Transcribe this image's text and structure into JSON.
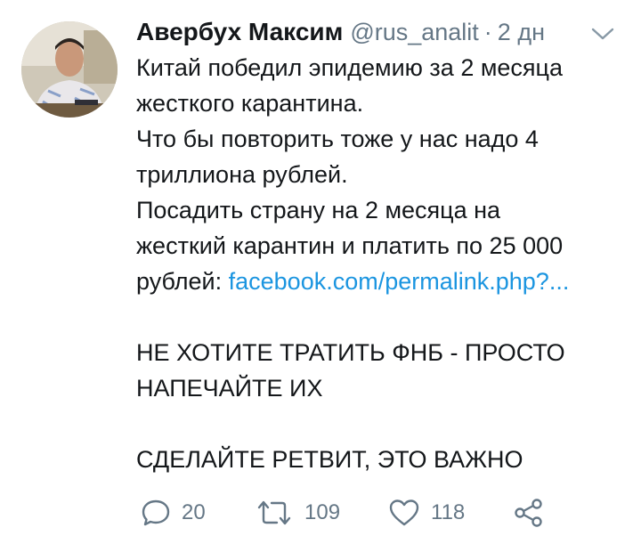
{
  "author": {
    "name": "Авербух Максим",
    "handle": "@rus_analit",
    "separator": "·",
    "time": "2 дн"
  },
  "tweet": {
    "lines": [
      "Китай победил эпидемию за 2 месяца",
      "жесткого карантина.",
      "Что бы повторить тоже у нас надо 4",
      "триллиона рублей.",
      "Посадить страну на 2 месяца на",
      "жесткий карантин и платить по 25 000"
    ],
    "last_line_prefix": "рублей: ",
    "link": "facebook.com/permalink.php?...",
    "caps_line_1": "НЕ ХОТИТЕ ТРАТИТЬ ФНБ - ПРОСТО",
    "caps_line_2": "НАПЕЧАЙТЕ ИХ",
    "caps_line_3": "СДЕЛАЙТЕ РЕТВИТ, ЭТО ВАЖНО"
  },
  "actions": {
    "replies": "20",
    "retweets": "109",
    "likes": "118"
  },
  "icons": {
    "reply": "reply-icon",
    "retweet": "retweet-icon",
    "like": "heart-icon",
    "share": "share-icon",
    "menu": "chevron-down-icon"
  },
  "colors": {
    "text": "#14171a",
    "muted": "#657786",
    "link": "#1b95e0"
  }
}
